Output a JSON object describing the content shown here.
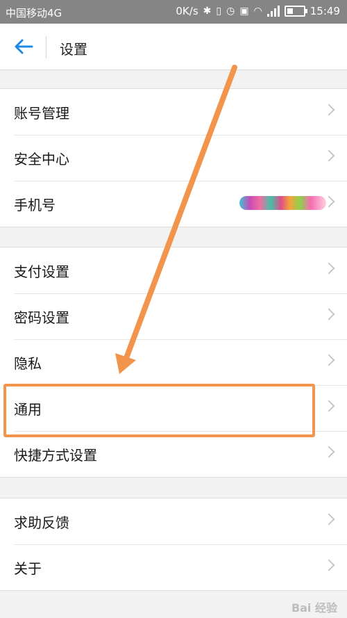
{
  "status_bar": {
    "carrier": "中国移动4G",
    "network_speed": "0K/s",
    "network_type": "4G",
    "time": "15:49"
  },
  "header": {
    "title": "设置",
    "back_icon": "arrow-left-icon"
  },
  "groups": [
    {
      "items": [
        {
          "label": "账号管理"
        },
        {
          "label": "安全中心"
        },
        {
          "label": "手机号"
        }
      ]
    },
    {
      "items": [
        {
          "label": "支付设置"
        },
        {
          "label": "密码设置"
        },
        {
          "label": "隐私"
        },
        {
          "label": "通用"
        },
        {
          "label": "快捷方式设置"
        }
      ]
    },
    {
      "items": [
        {
          "label": "求助反馈"
        },
        {
          "label": "关于"
        }
      ]
    }
  ],
  "colors": {
    "accent_blue": "#1e88e5",
    "annotation_orange": "#f2944b"
  },
  "watermark": "Bai 经验"
}
